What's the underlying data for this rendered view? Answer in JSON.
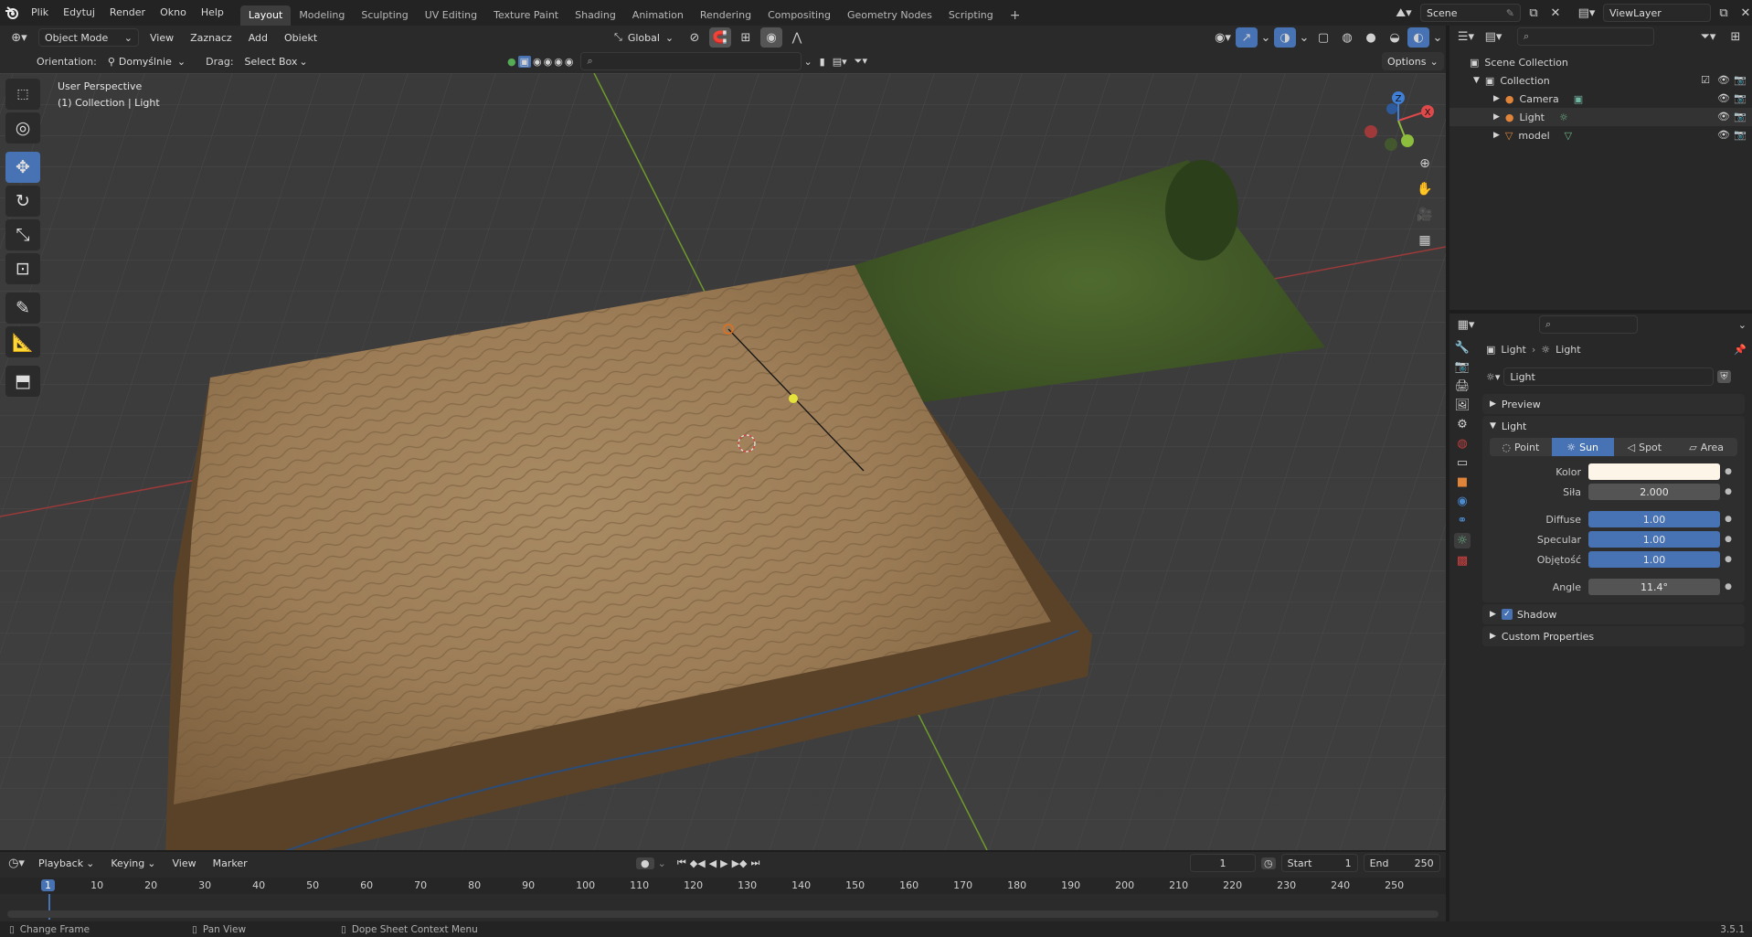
{
  "menu": {
    "items": [
      "Plik",
      "Edytuj",
      "Render",
      "Okno",
      "Help"
    ]
  },
  "workspaces": [
    "Layout",
    "Modeling",
    "Sculpting",
    "UV Editing",
    "Texture Paint",
    "Shading",
    "Animation",
    "Rendering",
    "Compositing",
    "Geometry Nodes",
    "Scripting"
  ],
  "add_workspace": "+",
  "scene": {
    "label": "Scene",
    "viewlayer": "ViewLayer"
  },
  "viewport_header": {
    "mode": "Object Mode",
    "menus": [
      "View",
      "Zaznacz",
      "Add",
      "Obiekt"
    ],
    "transform": "Global",
    "orientation_label": "Orientation:",
    "orientation_value": "Domyślnie",
    "drag_label": "Drag:",
    "drag_value": "Select Box",
    "options": "Options"
  },
  "overlay_text": {
    "line1": "User Perspective",
    "line2": "(1) Collection | Light"
  },
  "gizmo": {
    "x": "X",
    "y": "Y",
    "z": "Z"
  },
  "outliner": {
    "root": "Scene Collection",
    "collection": "Collection",
    "items": [
      {
        "name": "Camera",
        "icon": "camera-icon"
      },
      {
        "name": "Light",
        "icon": "light-icon"
      },
      {
        "name": "model",
        "icon": "mesh-icon"
      }
    ]
  },
  "properties": {
    "breadcrumb": [
      "Light",
      "Light"
    ],
    "datablock": "Light",
    "preview_title": "Preview",
    "light_title": "Light",
    "types": [
      "Point",
      "Sun",
      "Spot",
      "Area"
    ],
    "active_type": "Sun",
    "fields": {
      "color_label": "Kolor",
      "color_value": "#fdf6e8",
      "strength_label": "Siła",
      "strength_value": "2.000",
      "diffuse_label": "Diffuse",
      "diffuse_value": "1.00",
      "specular_label": "Specular",
      "specular_value": "1.00",
      "volume_label": "Objętość",
      "volume_value": "1.00",
      "angle_label": "Angle",
      "angle_value": "11.4°"
    },
    "shadow_title": "Shadow",
    "custom_title": "Custom Properties"
  },
  "timeline": {
    "menus": [
      "Playback",
      "Keying",
      "View",
      "Marker"
    ],
    "current_frame": "1",
    "start_label": "Start",
    "start_value": "1",
    "end_label": "End",
    "end_value": "250",
    "frames": [
      "1",
      "10",
      "20",
      "30",
      "40",
      "50",
      "60",
      "70",
      "80",
      "90",
      "100",
      "110",
      "120",
      "130",
      "140",
      "150",
      "160",
      "170",
      "180",
      "190",
      "200",
      "210",
      "220",
      "230",
      "240",
      "250"
    ]
  },
  "status": {
    "change_frame": "Change Frame",
    "pan_view": "Pan View",
    "context_menu": "Dope Sheet Context Menu",
    "version": "3.5.1"
  },
  "colors": {
    "accent": "#4772b3",
    "x_axis": "#e0494a",
    "y_axis": "#8cbd3d",
    "z_axis": "#3f7fd6"
  }
}
